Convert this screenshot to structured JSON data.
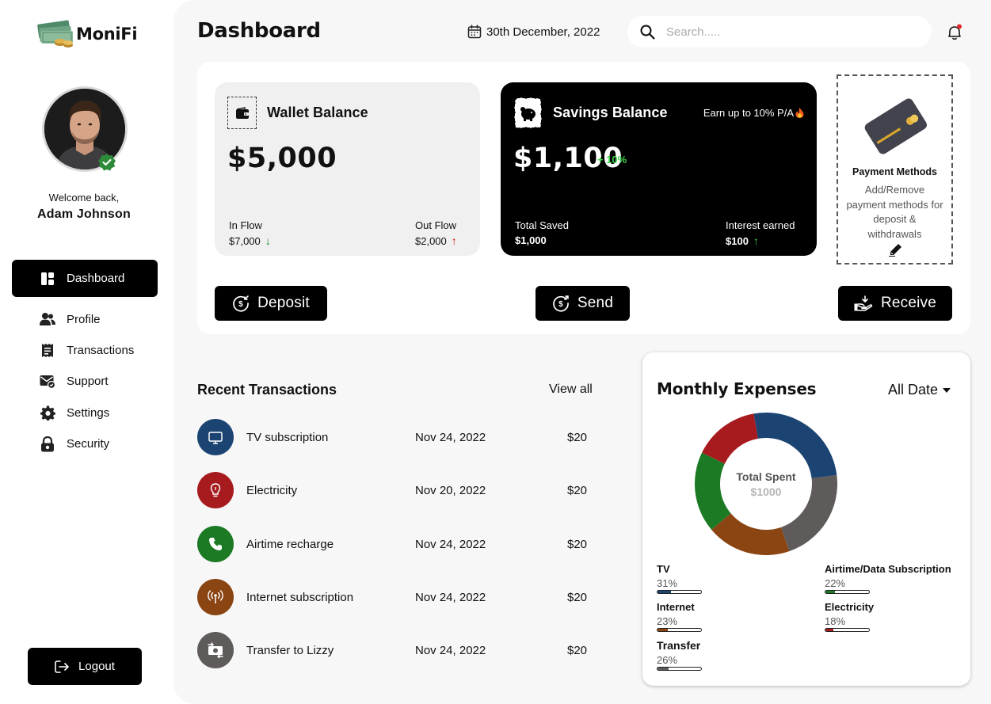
{
  "app": {
    "name": "MoniFi"
  },
  "user": {
    "welcome": "Welcome back,",
    "name": "Adam Johnson"
  },
  "nav": [
    {
      "label": "Dashboard",
      "icon": "dashboard-icon",
      "active": true
    },
    {
      "label": "Profile",
      "icon": "users-icon"
    },
    {
      "label": "Transactions",
      "icon": "receipt-icon"
    },
    {
      "label": "Support",
      "icon": "mail-support-icon"
    },
    {
      "label": "Settings",
      "icon": "gear-icon"
    },
    {
      "label": "Security",
      "icon": "lock-icon"
    }
  ],
  "logout_label": "Logout",
  "header": {
    "title": "Dashboard",
    "date": "30th December, 2022",
    "search_placeholder": "Search....."
  },
  "wallet": {
    "title": "Wallet Balance",
    "amount": "$5,000",
    "in_label": "In Flow",
    "in_value": "$7,000",
    "out_label": "Out Flow",
    "out_value": "$2,000"
  },
  "savings": {
    "title": "Savings Balance",
    "earn": "Earn up to 10% P/A",
    "amount": "$1,100",
    "growth": "+ 10%",
    "saved_label": "Total Saved",
    "saved_value": "$1,000",
    "interest_label": "Interest earned",
    "interest_value": "$100"
  },
  "payment": {
    "title": "Payment Methods",
    "desc": "Add/Remove payment methods for deposit & withdrawals"
  },
  "actions": {
    "deposit": "Deposit",
    "send": "Send",
    "receive": "Receive"
  },
  "transactions": {
    "title": "Recent Transactions",
    "view_all": "View all",
    "rows": [
      {
        "name": "TV subscription",
        "date": "Nov 24, 2022",
        "amount": "$20",
        "icon": "tv-icon",
        "color": "#1b4472"
      },
      {
        "name": "Electricity",
        "date": "Nov 20, 2022",
        "amount": "$20",
        "icon": "bulb-icon",
        "color": "#a71b1f"
      },
      {
        "name": "Airtime recharge",
        "date": "Nov 24, 2022",
        "amount": "$20",
        "icon": "phone-icon",
        "color": "#1c7a24"
      },
      {
        "name": "Internet subscription",
        "date": "Nov 24, 2022",
        "amount": "$20",
        "icon": "wifi-icon",
        "color": "#8a4513"
      },
      {
        "name": "Transfer to Lizzy",
        "date": "Nov 24, 2022",
        "amount": "$20",
        "icon": "transfer-icon",
        "color": "#5f5b5b"
      }
    ]
  },
  "expenses": {
    "title": "Monthly Expenses",
    "filter": "All Date",
    "center_label": "Total Spent",
    "center_value": "$1000",
    "categories": [
      {
        "name": "TV",
        "pct": "31%",
        "value": 31,
        "color": "#1b4472"
      },
      {
        "name": "Airtime/Data Subscription",
        "pct": "22%",
        "value": 22,
        "color": "#1c7a24"
      },
      {
        "name": "Internet",
        "pct": "23%",
        "value": 23,
        "color": "#8a4513"
      },
      {
        "name": "Electricity",
        "pct": "18%",
        "value": 18,
        "color": "#a71b1f"
      },
      {
        "name": "Transfer",
        "pct": "26%",
        "value": 26,
        "color": "#5f5b5b"
      }
    ]
  },
  "chart_data": {
    "type": "pie",
    "title": "Monthly Expenses",
    "categories": [
      "TV",
      "Airtime/Data Subscription",
      "Internet",
      "Electricity",
      "Transfer"
    ],
    "values": [
      31,
      22,
      23,
      18,
      26
    ],
    "colors": [
      "#1b4472",
      "#1c7a24",
      "#8a4513",
      "#a71b1f",
      "#5f5b5b"
    ]
  }
}
